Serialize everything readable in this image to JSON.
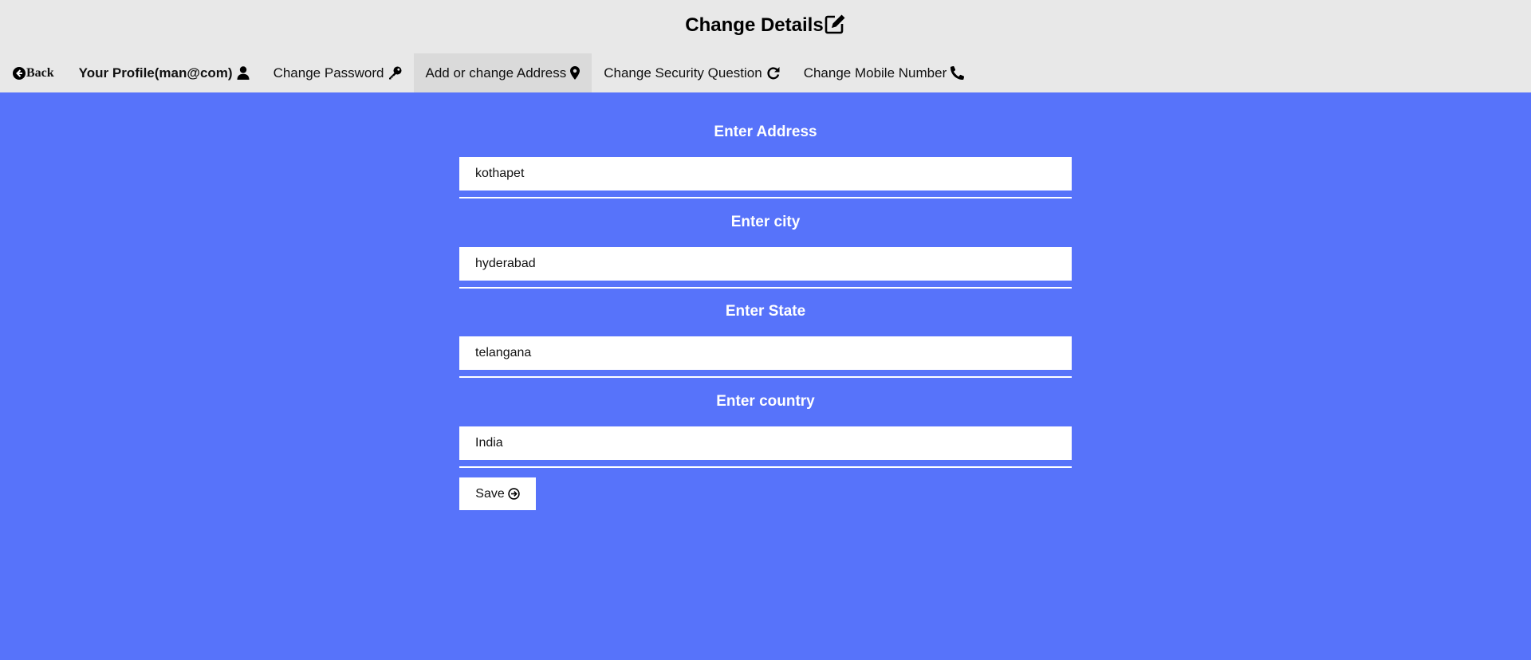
{
  "header": {
    "title": "Change Details",
    "title_icon": "edit-icon"
  },
  "nav": {
    "back_label": "Back",
    "profile_label": "Your Profile(man@com)",
    "password_label": "Change Password",
    "address_label": "Add or change Address",
    "security_label": "Change Security Question",
    "mobile_label": "Change Mobile Number",
    "active_tab": "Add or change Address"
  },
  "form": {
    "address_label": "Enter Address",
    "address_value": "kothapet",
    "city_label": "Enter city",
    "city_value": "hyderabad",
    "state_label": "Enter State",
    "state_value": "telangana",
    "country_label": "Enter country",
    "country_value": "India",
    "save_label": "Save"
  },
  "colors": {
    "background": "#5773fa",
    "header_bg": "#e8e8e8",
    "active_tab_bg": "#dadada",
    "field_bg": "#ffffff"
  }
}
